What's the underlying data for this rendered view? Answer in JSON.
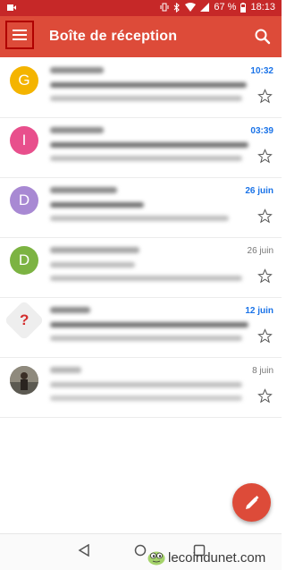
{
  "status_bar": {
    "battery": "67 %",
    "time": "18:13"
  },
  "header": {
    "title": "Boîte de réception"
  },
  "colors": {
    "accent": "#dd4b39",
    "status": "#c62828",
    "unread_date": "#1a73e8"
  },
  "icons": {
    "menu": "menu-icon",
    "search": "search-icon",
    "star": "star-icon",
    "compose": "pencil-icon"
  },
  "emails": [
    {
      "avatar_letter": "G",
      "avatar_color": "#f4b400",
      "date": "10:32",
      "unread": true
    },
    {
      "avatar_letter": "I",
      "avatar_color": "#e84f8c",
      "date": "03:39",
      "unread": true
    },
    {
      "avatar_letter": "D",
      "avatar_color": "#a889d3",
      "date": "26 juin",
      "unread": true
    },
    {
      "avatar_letter": "D",
      "avatar_color": "#7cb342",
      "date": "26 juin",
      "unread": false
    },
    {
      "avatar_letter": "?",
      "avatar_color": "#eeeeee",
      "date": "12 juin",
      "unread": true
    },
    {
      "avatar_letter": "",
      "avatar_color": "#6d6a62",
      "date": "8 juin",
      "unread": false
    }
  ],
  "watermark": {
    "text": "lecoindunet.com"
  }
}
